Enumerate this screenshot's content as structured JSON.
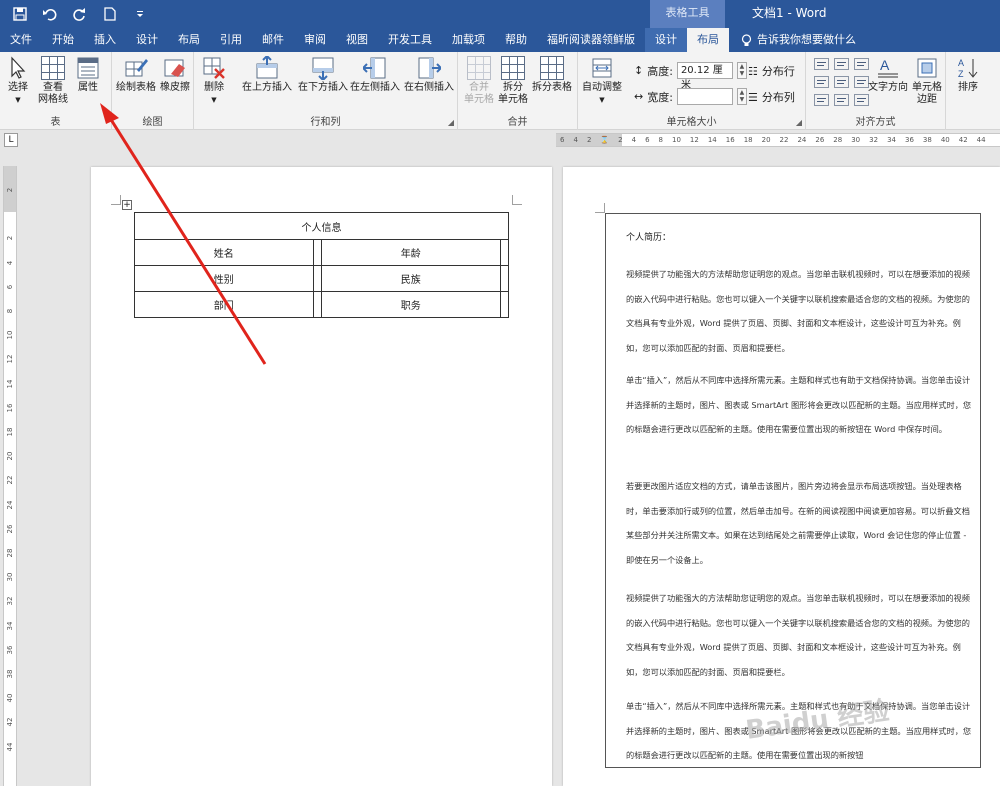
{
  "titlebar": {
    "quick_access": [
      "save-icon",
      "undo-icon",
      "redo-icon",
      "new-doc-icon",
      "customize-icon"
    ],
    "context_tab_group": "表格工具",
    "document_title": "文档1 - Word"
  },
  "tabs": [
    {
      "label": "文件"
    },
    {
      "label": "开始"
    },
    {
      "label": "插入"
    },
    {
      "label": "设计"
    },
    {
      "label": "布局"
    },
    {
      "label": "引用"
    },
    {
      "label": "邮件"
    },
    {
      "label": "审阅"
    },
    {
      "label": "视图"
    },
    {
      "label": "开发工具"
    },
    {
      "label": "加载项"
    },
    {
      "label": "帮助"
    },
    {
      "label": "福昕阅读器领鲜版"
    },
    {
      "label": "设计"
    },
    {
      "label": "布局"
    }
  ],
  "tell_me": "告诉我你想要做什么",
  "ribbon": {
    "table_group": {
      "label": "表",
      "select": "选择",
      "view_gridlines_1": "查看",
      "view_gridlines_2": "网格线",
      "properties": "属性"
    },
    "draw_group": {
      "label": "绘图",
      "draw_table": "绘制表格",
      "eraser": "橡皮擦"
    },
    "rows_cols_group": {
      "label": "行和列",
      "delete": "删除",
      "insert_above": "在上方插入",
      "insert_below": "在下方插入",
      "insert_left": "在左侧插入",
      "insert_right": "在右侧插入"
    },
    "merge_group": {
      "label": "合并",
      "merge_cells_1": "合并",
      "merge_cells_2": "单元格",
      "split_cells_1": "拆分",
      "split_cells_2": "单元格",
      "split_table": "拆分表格"
    },
    "cell_size_group": {
      "label": "单元格大小",
      "autofit": "自动调整",
      "height_label": "高度:",
      "height_value": "20.12 厘米",
      "width_label": "宽度:",
      "width_value": "",
      "distribute_rows": "分布行",
      "distribute_cols": "分布列"
    },
    "alignment_group": {
      "label": "对齐方式",
      "text_direction": "文字方向",
      "cell_margins_1": "单元格",
      "cell_margins_2": "边距"
    },
    "data_group": {
      "sort": "排序"
    }
  },
  "hruler_ticks": [
    "6",
    "4",
    "2",
    "",
    "2",
    "4",
    "6",
    "8",
    "10",
    "12",
    "14",
    "16",
    "18",
    "20",
    "22",
    "24",
    "26",
    "28",
    "30",
    "32",
    "34",
    "36",
    "38",
    "40",
    "42",
    "44"
  ],
  "vruler_ticks": [
    "2",
    "",
    "2",
    "4",
    "6",
    "8",
    "10",
    "12",
    "14",
    "16",
    "18",
    "20",
    "22",
    "24",
    "26",
    "28",
    "30",
    "32",
    "34",
    "36",
    "38",
    "40",
    "42",
    "44"
  ],
  "page1_table": {
    "title": "个人信息",
    "rows": [
      [
        "姓名",
        "",
        "年龄",
        ""
      ],
      [
        "性别",
        "",
        "民族",
        ""
      ],
      [
        "部门",
        "",
        "职务",
        ""
      ]
    ]
  },
  "page2": {
    "title": "个人简历：",
    "paragraphs": [
      "视频提供了功能强大的方法帮助您证明您的观点。当您单击联机视频时，可以在想要添加的视频的嵌入代码中进行粘贴。您也可以键入一个关键字以联机搜索最适合您的文档的视频。为使您的文档具有专业外观，Word 提供了页眉、页脚、封面和文本框设计，这些设计可互为补充。例如，您可以添加匹配的封面、页眉和提要栏。",
      "单击“插入”，然后从不同库中选择所需元素。主题和样式也有助于文档保持协调。当您单击设计并选择新的主题时，图片、图表或 SmartArt 图形将会更改以匹配新的主题。当应用样式时，您的标题会进行更改以匹配新的主题。使用在需要位置出现的新按钮在 Word 中保存时间。",
      "若要更改图片适应文档的方式，请单击该图片，图片旁边将会显示布局选项按钮。当处理表格时，单击要添加行或列的位置，然后单击加号。在新的阅读视图中阅读更加容易。可以折叠文档某些部分并关注所需文本。如果在达到结尾处之前需要停止读取，Word 会记住您的停止位置 - 即使在另一个设备上。",
      "视频提供了功能强大的方法帮助您证明您的观点。当您单击联机视频时，可以在想要添加的视频的嵌入代码中进行粘贴。您也可以键入一个关键字以联机搜索最适合您的文档的视频。为使您的文档具有专业外观，Word 提供了页眉、页脚、封面和文本框设计，这些设计可互为补充。例如，您可以添加匹配的封面、页眉和提要栏。",
      "单击“插入”，然后从不同库中选择所需元素。主题和样式也有助于文档保持协调。当您单击设计并选择新的主题时，图片、图表或 SmartArt 图形将会更改以匹配新的主题。当应用样式时，您的标题会进行更改以匹配新的主题。使用在需要位置出现的新按钮"
    ]
  },
  "colors": {
    "title_bar": "#2b579a",
    "annotation_arrow": "#e0241c",
    "ribbon_bg": "#f3f3f3"
  }
}
